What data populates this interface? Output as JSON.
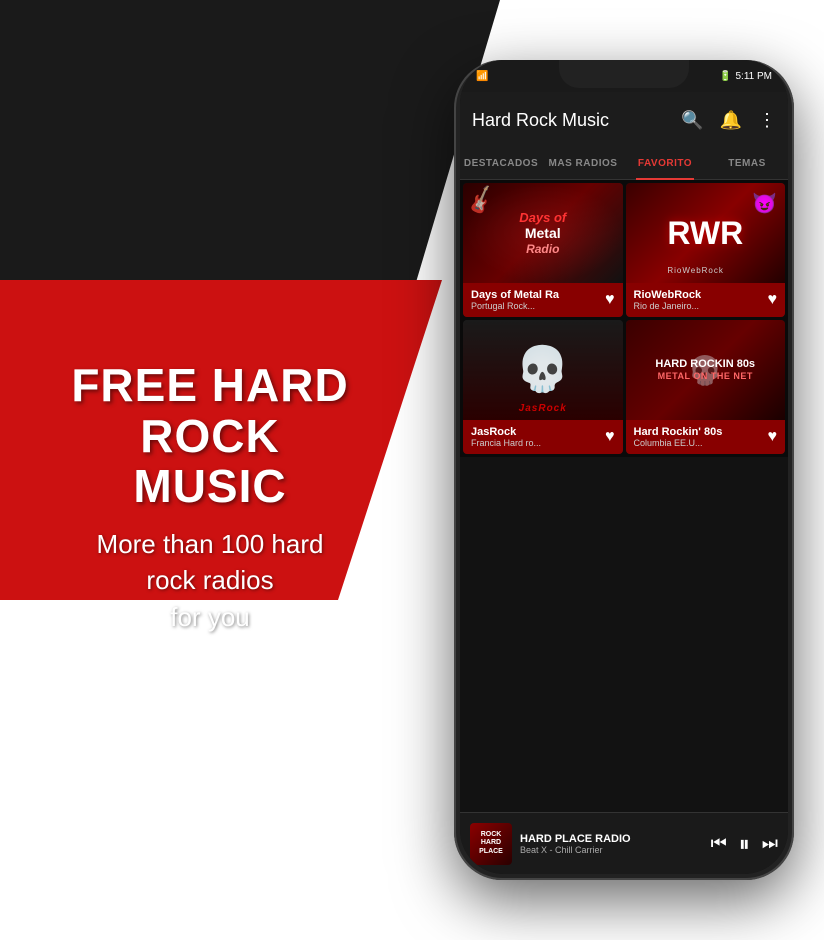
{
  "background": {
    "black_visible": true,
    "red_visible": true
  },
  "promo": {
    "headline_line1": "FREE HARD ROCK",
    "headline_line2": "MUSIC",
    "subtext_line1": "More than 100 hard",
    "subtext_line2": "rock radios",
    "subtext_line3": "for you"
  },
  "status_bar": {
    "time": "5:11 PM",
    "battery": "🔋",
    "signal": "📶"
  },
  "app_header": {
    "title": "Hard Rock Music",
    "icons": {
      "search": "🔍",
      "alarm": "🔔",
      "more": "⋮"
    }
  },
  "tabs": [
    {
      "label": "DESTACADOS",
      "active": false
    },
    {
      "label": "MAS RADIOS",
      "active": false
    },
    {
      "label": "FAVORITO",
      "active": true
    },
    {
      "label": "TEMAS",
      "active": false
    }
  ],
  "radios": [
    {
      "name": "Days of Metal Ra",
      "description": "Portugal Rock...",
      "thumb_type": "metal",
      "label1": "Days of",
      "label2": "Metal",
      "label3": "Radio"
    },
    {
      "name": "RioWebRock",
      "description": "Rio de Janeiro...",
      "thumb_type": "rio",
      "label": "RWR",
      "sublabel": "RioWebRock"
    },
    {
      "name": "JasRock",
      "description": "Francia Hard ro...",
      "thumb_type": "jas",
      "label": "JasRock"
    },
    {
      "name": "Hard Rockin' 80s",
      "description": "Columbia EE.U...",
      "thumb_type": "80s",
      "label1": "HARD ROCKIN 80s",
      "label2": "METAL ON THE NET"
    }
  ],
  "now_playing": {
    "station": "HARD PLACE RADIO",
    "track": "Beat X - Chill Carrier",
    "thumb_text": "ROCK\nHARD\nPLACE"
  }
}
